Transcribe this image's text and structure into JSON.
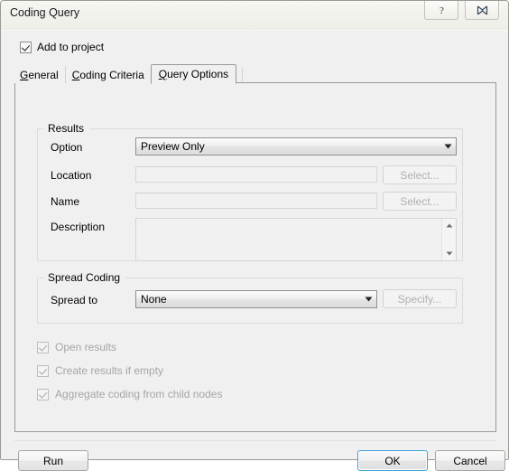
{
  "window": {
    "title": "Coding Query",
    "help_button": "?",
    "close_button": "X"
  },
  "add_to_project": {
    "label": "Add to project",
    "checked": true
  },
  "tabs": [
    {
      "label": "General",
      "accel": "G",
      "rest": "eneral",
      "active": false
    },
    {
      "label": "Coding Criteria",
      "accel": "C",
      "rest": "oding Criteria",
      "active": false
    },
    {
      "label": "Query Options",
      "accel": "Q",
      "rest": "uery Options",
      "active": true
    }
  ],
  "results_group": {
    "title": "Results",
    "option_label": "Option",
    "option_value": "Preview Only",
    "location_label": "Location",
    "location_value": "",
    "location_button": "Select...",
    "name_label": "Name",
    "name_value": "",
    "name_button": "Select...",
    "description_label": "Description",
    "description_value": ""
  },
  "spread_group": {
    "title": "Spread Coding",
    "spread_to_label": "Spread to",
    "spread_to_value": "None",
    "specify_button": "Specify..."
  },
  "checkboxes": [
    {
      "label": "Open results",
      "checked": true,
      "enabled": false
    },
    {
      "label": "Create results if empty",
      "checked": true,
      "enabled": false
    },
    {
      "label": "Aggregate coding from child nodes",
      "checked": true,
      "enabled": false
    }
  ],
  "footer": {
    "run_button": "Run",
    "ok_button": "OK",
    "cancel_button": "Cancel"
  },
  "colors": {
    "dialog_background": "#f0f0f0",
    "titlebar": "#f3f3ee",
    "default_button_accent": "#3c9fd4",
    "disabled_text": "#a6a6a6",
    "border": "#9a9a94"
  }
}
